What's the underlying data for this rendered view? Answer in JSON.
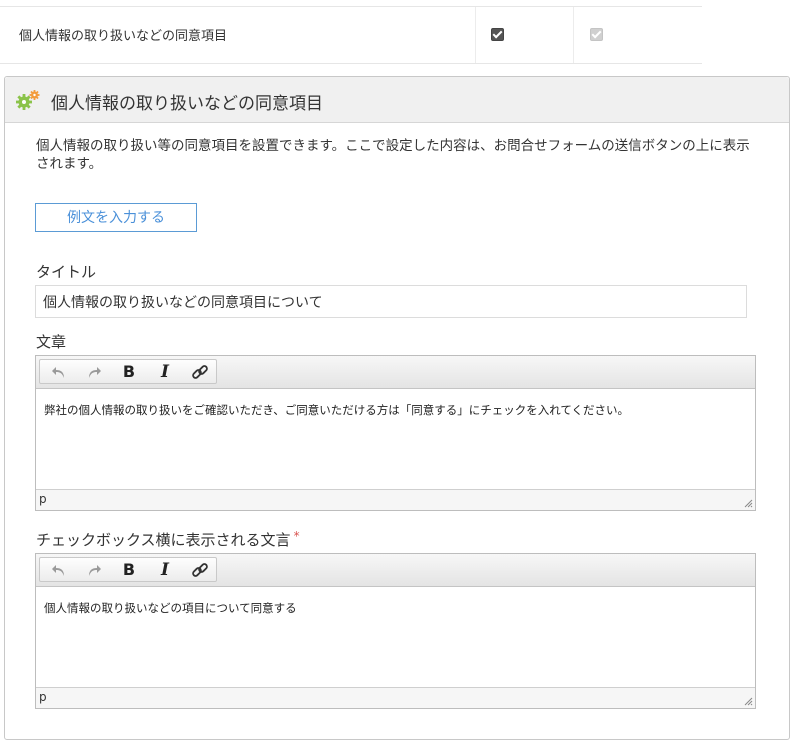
{
  "consent_row": {
    "label": "個人情報の取り扱いなどの同意項目",
    "checkbox_enabled": true,
    "checkbox_disabled": true
  },
  "panel": {
    "title": "個人情報の取り扱いなどの同意項目",
    "icon": "gears-icon",
    "description": "個人情報の取り扱い等の同意項目を設置できます。ここで設定した内容は、お問合せフォームの送信ボタンの上に表示されます。",
    "example_button": "例文を入力する"
  },
  "title_field": {
    "label": "タイトル",
    "value": "個人情報の取り扱いなどの同意項目について"
  },
  "body_field": {
    "label": "文章",
    "content": "弊社の個人情報の取り扱いをご確認いただき、ご同意いただける方は「同意する」にチェックを入れてください。",
    "path": "p"
  },
  "checkbox_text_field": {
    "label": "チェックボックス横に表示される文言",
    "required_mark": "*",
    "content": "個人情報の取り扱いなどの項目について同意する",
    "path": "p"
  },
  "toolbar": {
    "undo": "undo-icon",
    "redo": "redo-icon",
    "bold": "B",
    "italic": "I",
    "link": "link-icon"
  },
  "colors": {
    "accent": "#4a90d9",
    "required": "#d9534f",
    "header_bg": "#f0f0f0"
  }
}
